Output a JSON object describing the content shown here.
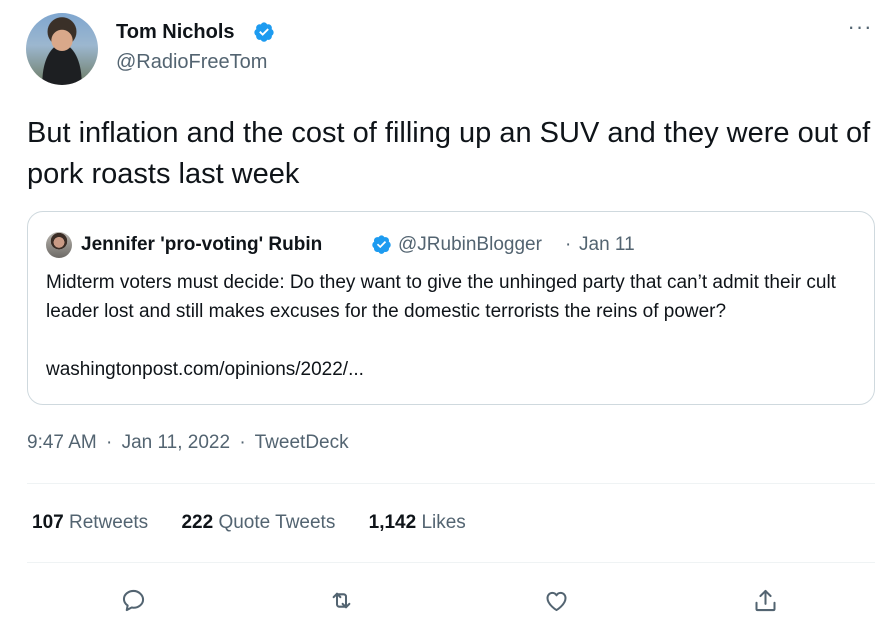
{
  "author": {
    "name": "Tom Nichols",
    "handle": "@RadioFreeTom",
    "verified_icon": "verified-badge-icon",
    "avatar_icon": "avatar"
  },
  "more_icon": "more-options-icon",
  "more_glyph": "···",
  "tweet": {
    "text": "But inflation and the cost of filling up an SUV and they were out of pork roasts last week"
  },
  "quote": {
    "name": "Jennifer 'pro-voting' Rubin",
    "handle": "@JRubinBlogger",
    "separator": "·",
    "date": "Jan 11",
    "text": "Midterm voters must decide: Do they want to give the unhinged party that can’t admit their cult leader lost and still makes excuses for the domestic terrorists the reins of power?",
    "link": "washingtonpost.com/opinions/2022/..."
  },
  "meta": {
    "time": "9:47 AM",
    "sep1": "·",
    "date": "Jan 11, 2022",
    "sep2": "·",
    "source": "TweetDeck"
  },
  "stats": {
    "retweets_count": "107",
    "retweets_label": "Retweets",
    "quotes_count": "222",
    "quotes_label": "Quote Tweets",
    "likes_count": "1,142",
    "likes_label": "Likes"
  },
  "actions": [
    "reply-icon",
    "retweet-icon",
    "like-icon",
    "share-icon"
  ],
  "colors": {
    "text_primary": "#0f1419",
    "text_secondary": "#536471",
    "verified_blue": "#1d9bf0",
    "border": "#cfd9de"
  }
}
